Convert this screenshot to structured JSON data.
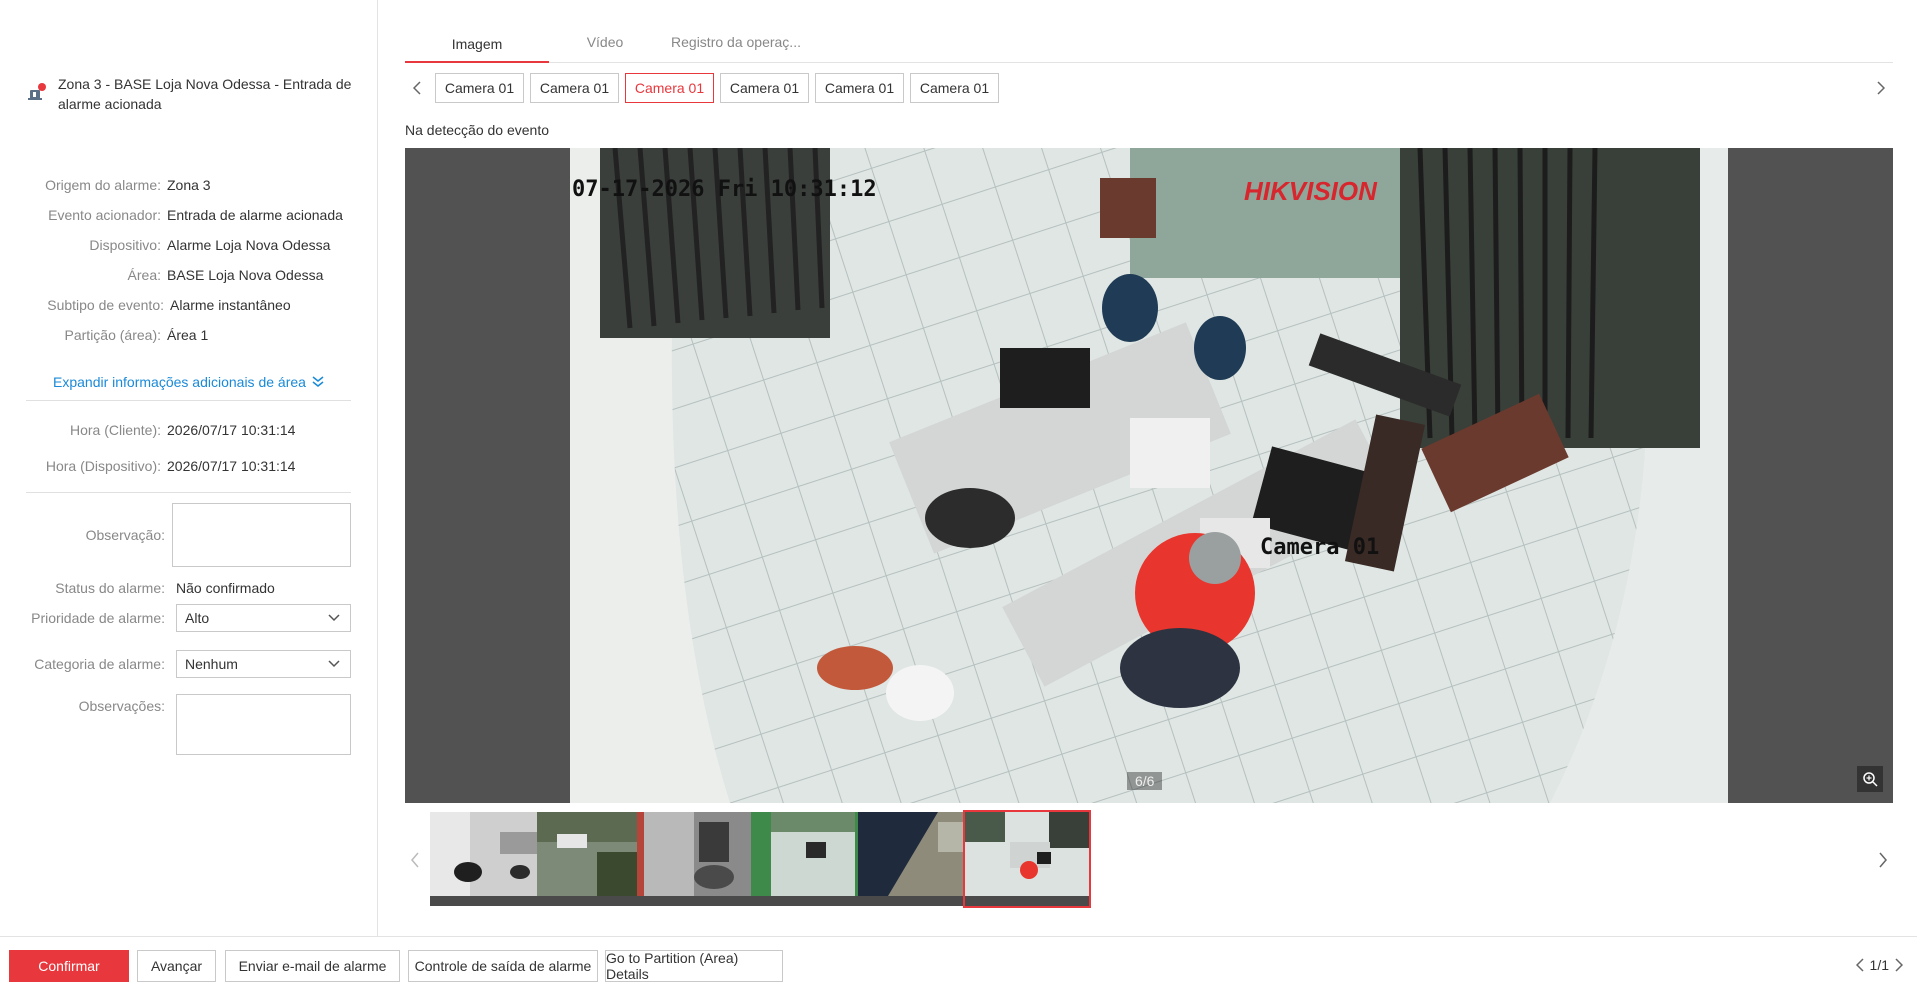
{
  "alarm": {
    "title": "Zona 3 - BASE Loja Nova Odessa - Entrada de alarme acionada",
    "icon": "alarm-siren-icon",
    "accent": "#e8383d"
  },
  "info": [
    {
      "label": "Origem do alarme:",
      "value": "Zona 3"
    },
    {
      "label": "Evento acionador:",
      "value": "Entrada de alarme acionada"
    },
    {
      "label": "Dispositivo:",
      "value": "Alarme Loja Nova Odessa"
    },
    {
      "label": "Área:",
      "value": "BASE Loja Nova Odessa"
    },
    {
      "label": "Subtipo de evento:",
      "value": "Alarme instantâneo"
    },
    {
      "label": "Partição (área):",
      "value": "Área 1"
    }
  ],
  "expand_link": "Expandir informações adicionais de área",
  "times": [
    {
      "label": "Hora (Cliente):",
      "value": "2026/07/17 10:31:14"
    },
    {
      "label": "Hora (Dispositivo):",
      "value": "2026/07/17 10:31:14"
    }
  ],
  "form": {
    "observacao_label": "Observação:",
    "observacao_value": "",
    "status_label": "Status do alarme:",
    "status_value": "Não confirmado",
    "priority_label": "Prioridade de alarme:",
    "priority_value": "Alto",
    "category_label": "Categoria de alarme:",
    "category_value": "Nenhum",
    "observacoes_label": "Observações:",
    "observacoes_value": ""
  },
  "tabs": [
    "Imagem",
    "Vídeo",
    "Registro da operaç..."
  ],
  "active_tab": 0,
  "cameras": [
    "Camera 01",
    "Camera 01",
    "Camera 01",
    "Camera 01",
    "Camera 01",
    "Camera 01"
  ],
  "active_camera": 2,
  "section_title": "Na detecção do evento",
  "viewer": {
    "osd_timestamp": "07-17-2026 Fri 10:31:12",
    "osd_brand": "HIKVISION",
    "osd_camera": "Camera 01",
    "counter": "6/6"
  },
  "thumbnails": [
    "thumb-1",
    "thumb-2",
    "thumb-3",
    "thumb-4",
    "thumb-5",
    "thumb-6"
  ],
  "active_thumbnail": 5,
  "footer": {
    "confirm": "Confirmar",
    "advance": "Avançar",
    "email": "Enviar e-mail de alarme",
    "output": "Controle de saída de alarme",
    "partition": "Go to Partition (Area) Details",
    "pager": "1/1"
  }
}
